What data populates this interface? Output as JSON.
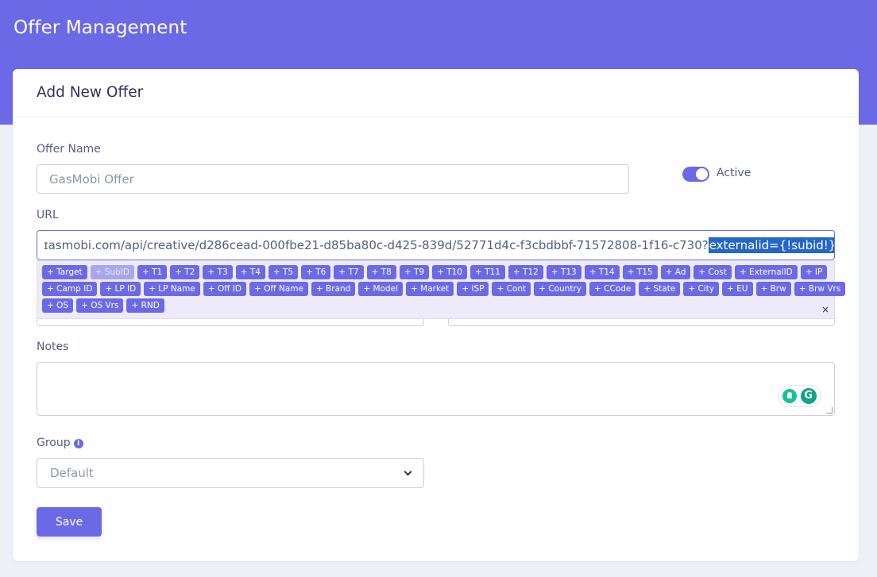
{
  "header": {
    "title": "Offer Management"
  },
  "card": {
    "title": "Add New Offer"
  },
  "offer_name": {
    "label": "Offer Name",
    "placeholder": "GasMobi Offer"
  },
  "active_toggle": {
    "label": "Active",
    "state": "on"
  },
  "url": {
    "label": "URL",
    "value_prefix": "ɪasmobi.com/api/creative/d286cead-000fbe21-d85ba80c-d425-839d/52771d4c-f3cbdbbf-71572808-1f16-c730?",
    "value_selected": "externalid={!subid!}"
  },
  "tags": {
    "rows": [
      [
        "+ Target",
        "+ SubID",
        "+ T1",
        "+ T2",
        "+ T3",
        "+ T4",
        "+ T5",
        "+ T6",
        "+ T7",
        "+ T8",
        "+ T9",
        "+ T10",
        "+ T11",
        "+ T12",
        "+ T13",
        "+ T14",
        "+ T15",
        "+ Ad",
        "+ Cost",
        "+ ExternalID",
        "+ IP"
      ],
      [
        "+ Camp ID",
        "+ LP ID",
        "+ LP Name",
        "+ Off ID",
        "+ Off Name",
        "+ Brand",
        "+ Model",
        "+ Market",
        "+ ISP",
        "+ Cont",
        "+ Country",
        "+ CCode",
        "+ State",
        "+ City",
        "+ EU",
        "+ Brw",
        "+ Brw Vrs"
      ],
      [
        "+ OS",
        "+ OS Vrs",
        "+ RND"
      ]
    ],
    "disabled": [
      "+ SubID"
    ],
    "close": "×"
  },
  "notes": {
    "label": "Notes",
    "value": ""
  },
  "group": {
    "label": "Group",
    "info": "i",
    "selected": "Default"
  },
  "save": {
    "label": "Save"
  },
  "colors": {
    "accent": "#6c69e6",
    "selection": "#2566c9",
    "grammarly": "#15c39a"
  }
}
